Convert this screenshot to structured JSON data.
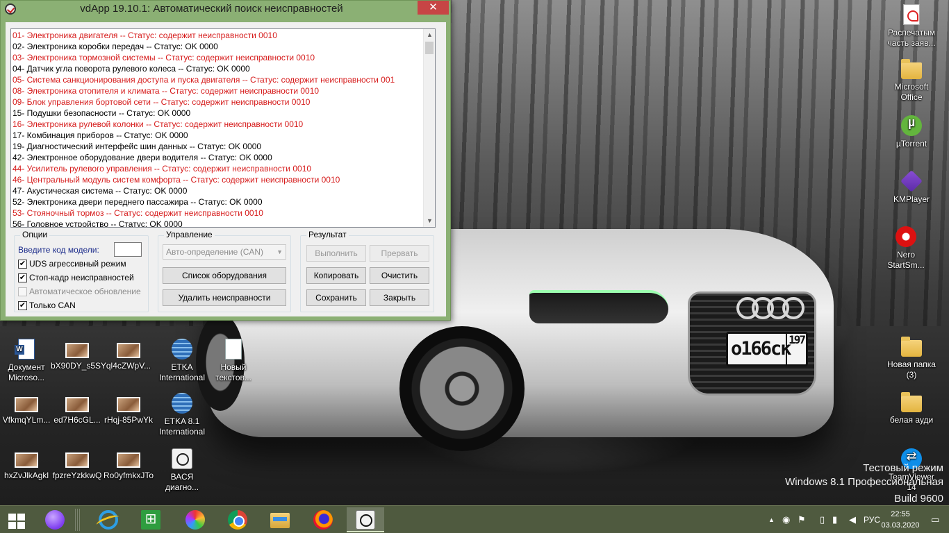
{
  "window": {
    "title": "vdApp 19.10.1:  Автоматический поиск неисправностей",
    "close_glyph": "✕",
    "modules": [
      {
        "text": "01- Электроника двигателя -- Статус: содержит неисправности 0010",
        "fault": true
      },
      {
        "text": "02- Электроника коробки передач -- Статус: OK 0000",
        "fault": false
      },
      {
        "text": "03- Электроника тормозной системы -- Статус: содержит неисправности 0010",
        "fault": true
      },
      {
        "text": "04- Датчик угла поворота рулевого колеса -- Статус: OK 0000",
        "fault": false
      },
      {
        "text": "05- Система санкционирования доступа и пуска двигателя -- Статус: содержит неисправности 001",
        "fault": true
      },
      {
        "text": "08- Электроника отопителя и климата -- Статус: содержит неисправности 0010",
        "fault": true
      },
      {
        "text": "09- Блок управления бортовой сети -- Статус: содержит неисправности 0010",
        "fault": true
      },
      {
        "text": "15- Подушки безопасности -- Статус: OK 0000",
        "fault": false
      },
      {
        "text": "16- Электроника рулевой колонки -- Статус: содержит неисправности 0010",
        "fault": true
      },
      {
        "text": "17- Комбинация приборов -- Статус: OK 0000",
        "fault": false
      },
      {
        "text": "19- Диагностический интерфейс шин данных -- Статус: OK 0000",
        "fault": false
      },
      {
        "text": "42- Электронное оборудование двери водителя -- Статус: OK 0000",
        "fault": false
      },
      {
        "text": "44- Усилитель рулевого управления -- Статус: содержит неисправности 0010",
        "fault": true
      },
      {
        "text": "46- Центральный модуль систем комфорта -- Статус: содержит неисправности 0010",
        "fault": true
      },
      {
        "text": "47- Акустическая система -- Статус: OK 0000",
        "fault": false
      },
      {
        "text": "52- Электроника двери переднего пассажира -- Статус: OK 0000",
        "fault": false
      },
      {
        "text": "53- Стояночный тормоз -- Статус: содержит неисправности 0010",
        "fault": true
      },
      {
        "text": "56- Головное устройство -- Статус: OK 0000",
        "fault": false
      }
    ],
    "scroll_up": "▲",
    "scroll_down": "▼",
    "options": {
      "title": "Опции",
      "model_code_label": "Введите код модели:",
      "model_code_value": "",
      "uds_label": "UDS агрессивный режим",
      "uds_checked": true,
      "freeze_label": "Стоп-кадр неисправностей",
      "freeze_checked": true,
      "autoupdate_label": "Автоматическое обновление",
      "autoupdate_checked": false,
      "can_only_label": "Только CAN",
      "can_only_checked": true
    },
    "control": {
      "title": "Управление",
      "mode_value": "Авто-определение (CAN)",
      "equipment_button": "Список оборудования",
      "delete_faults_button": "Удалить неисправности"
    },
    "result": {
      "title": "Результат",
      "run_button": "Выполнить",
      "abort_button": "Прервать",
      "copy_button": "Копировать",
      "clear_button": "Очистить",
      "save_button": "Сохранить",
      "close_button": "Закрыть"
    }
  },
  "desktop": {
    "icons_left": [
      {
        "label": "Документ Microso...",
        "icon": "word-doc-icon"
      },
      {
        "label": "bX90DY_s5SY",
        "icon": "photo-icon"
      },
      {
        "label": "ql4cZWpV...",
        "icon": "photo-icon"
      },
      {
        "label": "ETKA International",
        "icon": "globe-icon"
      },
      {
        "label": "Новый текстов...",
        "icon": "text-doc-icon"
      },
      {
        "label": "VfkmqYLm...",
        "icon": "photo-icon"
      },
      {
        "label": "ed7H6cGL...",
        "icon": "photo-icon"
      },
      {
        "label": "rHqj-85PwYk",
        "icon": "photo-icon"
      },
      {
        "label": "ETKA 8.1 International",
        "icon": "globe-icon"
      },
      {
        "label": "hxZvJlkAgkl",
        "icon": "photo-icon"
      },
      {
        "label": "fpzreYzkkwQ",
        "icon": "photo-icon"
      },
      {
        "label": "Ro0yfmkxJTo",
        "icon": "photo-icon"
      },
      {
        "label": "ВАСЯ диагно...",
        "icon": "vasya-icon"
      }
    ],
    "icons_right": [
      {
        "label": "Распечатым часть заяв...",
        "icon": "pdf-icon"
      },
      {
        "label": "Microsoft Office",
        "icon": "folder-icon"
      },
      {
        "label": "µTorrent",
        "icon": "utorrent-icon"
      },
      {
        "label": "KMPlayer",
        "icon": "kmplayer-icon"
      },
      {
        "label": "Nero StartSm...",
        "icon": "nero-icon"
      },
      {
        "label": "Новая папка (3)",
        "icon": "folder-icon"
      },
      {
        "label": "белая ауди",
        "icon": "folder-icon"
      },
      {
        "label": "TeamViewer 14",
        "icon": "teamviewer-icon"
      }
    ],
    "watermark": {
      "line1": "Тестовый режим",
      "line2": "Windows 8.1 Профессиональная",
      "line3": "Build 9600"
    },
    "plate": {
      "number": "о166ск",
      "region": "197"
    }
  },
  "taskbar": {
    "pinned": [
      "start-icon",
      "alice-icon",
      "internet-explorer-icon",
      "store-icon",
      "pinwheel-icon",
      "chrome-icon",
      "file-explorer-icon",
      "firefox-icon",
      "vasya-icon"
    ],
    "tray": {
      "language": "РУС",
      "time": "22:55",
      "date": "03.03.2020"
    }
  }
}
